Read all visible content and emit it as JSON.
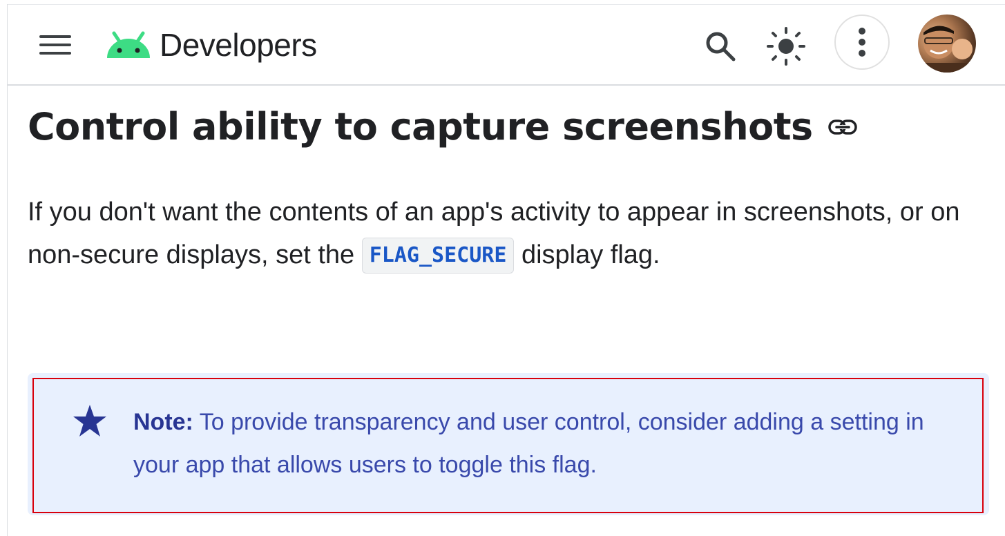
{
  "header": {
    "brand": "Developers",
    "brand_color": "#3ddc84",
    "icons": [
      "menu-icon",
      "search-icon",
      "brightness-icon",
      "more-vert-icon"
    ],
    "avatar_alt": "avatar"
  },
  "main": {
    "title": "Control ability to capture screenshots",
    "paragraph": {
      "before": "If you don't want the contents of an app's activity to appear in screenshots, or on non-secure displays, set the ",
      "code": "FLAG_SECURE",
      "after": " display flag."
    },
    "note": {
      "label": "Note:",
      "text": " To provide transparency and user control, consider adding a setting in your app that allows users to toggle this flag.",
      "background": "#e8f0fe",
      "text_color": "#3949ab",
      "highlight_color": "#d8000c"
    }
  }
}
